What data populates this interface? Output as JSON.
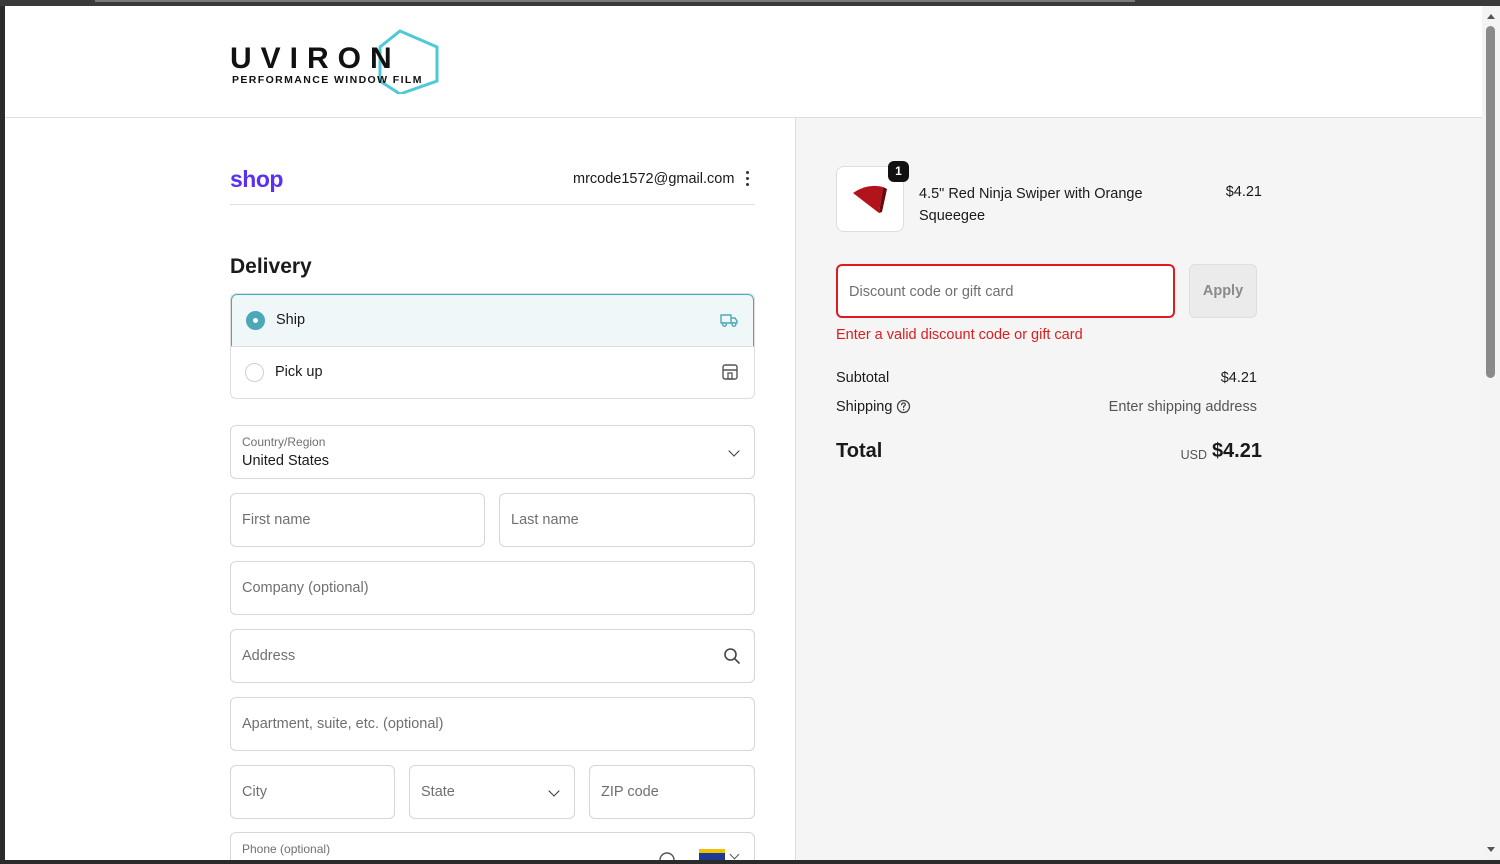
{
  "brand": {
    "logo_word": "UVIRON",
    "logo_tagline": "PERFORMANCE WINDOW FILM",
    "accent": "#4fc9d6"
  },
  "account": {
    "shop_logo": "shop",
    "email": "mrcode1572@gmail.com"
  },
  "delivery": {
    "title": "Delivery",
    "options": [
      {
        "label": "Ship",
        "selected": true,
        "icon": "truck-icon"
      },
      {
        "label": "Pick up",
        "selected": false,
        "icon": "store-icon"
      }
    ]
  },
  "form": {
    "country_label": "Country/Region",
    "country_value": "United States",
    "first_name_ph": "First name",
    "last_name_ph": "Last name",
    "company_ph": "Company (optional)",
    "address_ph": "Address",
    "apartment_ph": "Apartment, suite, etc. (optional)",
    "city_ph": "City",
    "state_ph": "State",
    "zip_ph": "ZIP code",
    "phone_label": "Phone (optional)"
  },
  "summary": {
    "item": {
      "name": "4.5\" Red Ninja Swiper with Orange Squeegee",
      "price": "$4.21",
      "quantity": "1"
    },
    "discount_placeholder": "Discount code or gift card",
    "apply_label": "Apply",
    "discount_error": "Enter a valid discount code or gift card",
    "subtotal_label": "Subtotal",
    "subtotal_value": "$4.21",
    "shipping_label": "Shipping",
    "shipping_value": "Enter shipping address",
    "total_label": "Total",
    "total_currency": "USD",
    "total_value": "$4.21"
  },
  "colors": {
    "selected_accent": "#4aa8b8",
    "error": "#dd1d1d",
    "shop_purple": "#5a31f4"
  }
}
